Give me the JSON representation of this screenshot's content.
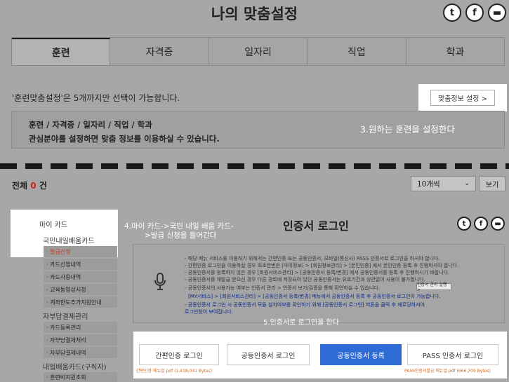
{
  "header": {
    "title": "나의 맞춤설정",
    "social": [
      {
        "icon": "twitter-icon",
        "glyph": "t"
      },
      {
        "icon": "facebook-icon",
        "glyph": "f"
      },
      {
        "icon": "chat-icon",
        "glyph": "▬"
      }
    ]
  },
  "tabs": [
    {
      "label": "훈련",
      "active": true
    },
    {
      "label": "자격증",
      "active": false
    },
    {
      "label": "일자리",
      "active": false
    },
    {
      "label": "직업",
      "active": false
    },
    {
      "label": "학과",
      "active": false
    }
  ],
  "notice": "'훈련맞춤설정'은 5개까지만 선택이 가능합니다.",
  "pref_button": "맞춤정보 설정  >",
  "info": {
    "line1": "훈련 / 자격증 / 일자리 / 직업 / 학과",
    "line2": "관심분야를 설정하면 맞춤 정보를 이용하실 수 있습니다."
  },
  "annotations": {
    "a3": "3.원하는 훈련을 설정한다",
    "a4_line1": "4.마이 카드->국민 내일 배움 카드-",
    "a4_line2": ">발급 신청을 들어간다",
    "a5": "5.인증서로 로그인을 한다"
  },
  "list": {
    "total_label": "전체",
    "total_count": "0",
    "total_suffix": "건",
    "per_page": "10개씩",
    "view_button": "보기"
  },
  "sidebar": {
    "head": "마이 카드",
    "subhead": "국민내일배움카드",
    "items": [
      {
        "label": "· 발급신청"
      },
      {
        "label": "· 카드신청내역"
      },
      {
        "label": "· 카드사용내역"
      },
      {
        "label": "· 교육동영상시청"
      },
      {
        "label": "· 계좌한도추가지원안내"
      }
    ],
    "section2": "자부담결제관리",
    "items2": [
      {
        "label": "· 카드등록관리"
      },
      {
        "label": "· 자부담결제처리"
      },
      {
        "label": "· 자부담결제내역"
      }
    ],
    "section3": "내일배움카드(구직자)",
    "items3": [
      {
        "label": "· 훈련비지원조회"
      }
    ]
  },
  "cert": {
    "title": "인증서 로그인",
    "guide_lines": [
      "- 해당 메뉴 서비스를 이용하기 위해서는 간편인증 또는 공동인증서, 모바일(통신사) PASS 인증서로 로그인을 하셔야 합니다.",
      "- 간편인증 로그인을 이용하실 경우 최초한번은 [마이정보] > [회원정보관리] > [본인인증] 에서 본인인증 등록 후 진행하셔야 합니다.",
      "- 공동인증서를 등록하지 않은 경우 [회원서비스관리] > [공동인증서 등록/변경] 에서 공동인증서를 등록 후 진행하시기 바랍니다.",
      "- 공동인증서를 재발급 받으신 경우 다른 경로에 저장되어 있던 공동인증서는 유효기간과 상관없이 사용이 불가합니다.",
      "- 공동인증서의 사용가능 여부는 인증서 관리 > 인증서 보기/검증을 통해 확인하실 수 있습니다.",
      "[MY서비스] > [회원서비스관리] > [공동인증서 등록/변경] 메뉴에서 공동인증서 등록 후 공동인증서 로그인이 가능합니다.",
      "- 공동인증서 로그인 시 공동인증서 모듈 설치여부를 확인하기 위해 [공동인증서 로그인] 버튼을 클릭 후 재로딩하셔야",
      "  로그인창이 보여집니다."
    ],
    "manage_button": "인증서 관리 실행  >",
    "buttons": [
      "간편인증 로그인",
      "공동인증서 로그인",
      "공동인증서 등록",
      "PASS 인증서 로그인"
    ],
    "file_left": "간편인증 메뉴얼.pdf (1,418,031 Bytes)",
    "file_right": "PASS인증서발급 매뉴얼.pdf (666,709 Bytes)"
  }
}
